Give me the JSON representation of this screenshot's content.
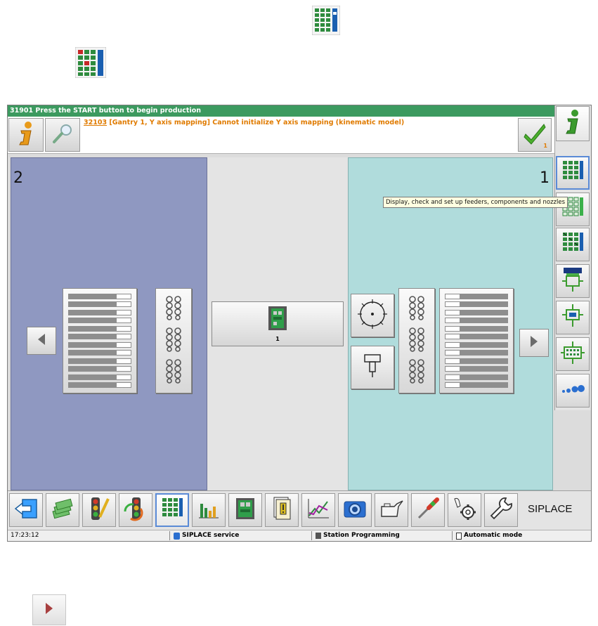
{
  "status_top": {
    "text": "31901 Press the START button to begin production"
  },
  "message": {
    "code": "32103",
    "text": " [Gantry 1, Y axis mapping] Cannot initialize Y axis mapping (kinematic model)",
    "ack_count": "1"
  },
  "stations": [
    {
      "number": "2"
    },
    {
      "number": "1"
    }
  ],
  "center": {
    "board_count": "1"
  },
  "tooltip": {
    "text": "Display, check and set up feeders, components and nozzles"
  },
  "toolbar": {
    "brand_label": "SIPLACE"
  },
  "status_bar": {
    "time": "17:23:12",
    "user": "SIPLACE service",
    "station": "Station Programming",
    "mode": "Automatic mode"
  },
  "colors": {
    "status_green": "#3c9a5f",
    "message_orange": "#e07b00",
    "station2_bg": "#8f98c1",
    "station1_bg": "#b0dcdc"
  },
  "icons": [
    "info-icon",
    "magnifier-icon",
    "check-icon",
    "setup-grid-icon",
    "component-grid-icon",
    "nozzle-grid-icon",
    "placement-icon",
    "pcb-transport-icon",
    "board-icon",
    "nozzles-icon",
    "back-icon",
    "money-icon",
    "traffic-light-icon",
    "refresh-icon",
    "bar-chart-icon",
    "pcb-icon",
    "report-icon",
    "graph-icon",
    "camera-icon",
    "oil-can-icon",
    "screwdriver-icon",
    "hand-gear-icon",
    "wrench-icon",
    "chevron-left-icon",
    "chevron-right-icon"
  ]
}
